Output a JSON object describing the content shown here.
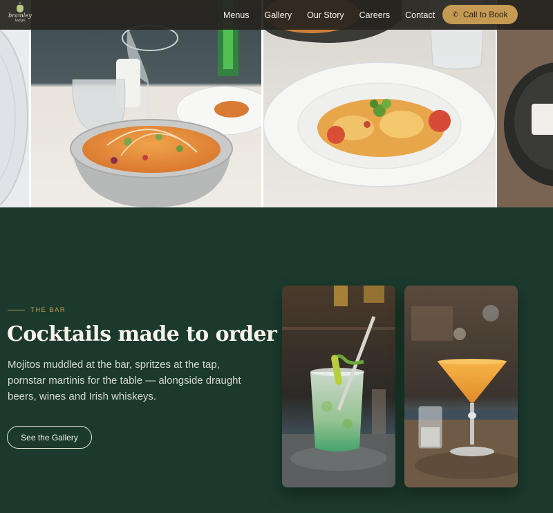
{
  "brand": {
    "logo_line1": "bramley",
    "logo_line2": "lodge"
  },
  "nav": {
    "items": [
      "Menus",
      "Gallery",
      "Our Story",
      "Careers",
      "Contact"
    ],
    "cta_label": "Call to Book",
    "cta_icon": "phone-icon"
  },
  "bar_section": {
    "eyebrow": "THE BAR",
    "headline": "Cocktails made to order",
    "body": "Mojitos muddled at the bar, spritzes at the tap, pornstar martinis for the table — alongside draught beers, wines and Irish whiskeys.",
    "button_label": "See the Gallery"
  },
  "colors": {
    "accent": "#c59a52",
    "section_bg": "#1b3a2d",
    "header_bg": "#26241e"
  }
}
